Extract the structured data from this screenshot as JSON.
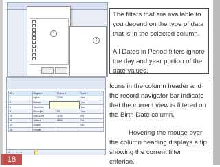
{
  "slide_number": "18",
  "colors": {
    "badge": "#c0504d",
    "frame": "#bcbcbc",
    "tooltip": "#ffffe1",
    "filtered_indicator": "#fbe9a8"
  },
  "top_note": {
    "paragraph1": "The filters that are available to you depend on the type of data that is in the selected column.",
    "paragraph2": "All Dates in Period filters ignore the day and year portion of the date values."
  },
  "bottom_note": {
    "paragraph1": "Icons in the column header and the record navigator bar indicate that the current view is filtered on the Birth Date column.",
    "paragraph2_lead": "Hovering the mouse over",
    "paragraph2_rest": "the column heading displays a tip showing the current filter criterion."
  },
  "filter_menu": {
    "callouts": [
      "1",
      "2"
    ]
  },
  "table_shot": {
    "headers": [
      "ID",
      "Region",
      "Phone",
      "Cost"
    ],
    "rows": [
      [
        "1",
        "Byers",
        "2220",
        "Yes"
      ],
      [
        "2",
        "Barros",
        "407 MT",
        "Yes"
      ],
      [
        "4",
        "Takahishi",
        "8822",
        "Yes"
      ],
      [
        "9",
        "Greenjar",
        "NP",
        "Yes"
      ],
      [
        "10",
        "Dye-Zone",
        "1100",
        "No"
      ],
      [
        "11",
        "Valdez",
        "3812",
        "No"
      ],
      [
        "12",
        "Deane",
        "",
        "No"
      ],
      [
        "15",
        "Phintill",
        "",
        ""
      ]
    ]
  }
}
